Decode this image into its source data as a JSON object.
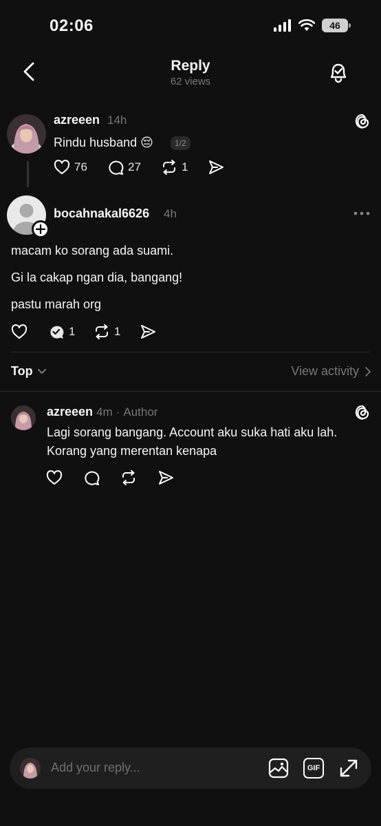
{
  "status_bar": {
    "time": "02:06",
    "battery": "46",
    "icons": [
      "signal-icon",
      "wifi-icon",
      "battery-icon"
    ]
  },
  "header": {
    "title": "Reply",
    "views": "62 views"
  },
  "parent_post": {
    "username": "azreeen",
    "time": "14h",
    "text": "Rindu husband 😔",
    "page_indicator": "1/2",
    "likes": "76",
    "comments": "27",
    "reposts": "1"
  },
  "main_post": {
    "username": "bocahnakal6626",
    "time": "4h",
    "lines": [
      "macam ko sorang ada suami.",
      "Gi la cakap ngan dia, bangang!",
      "pastu marah org"
    ],
    "comments": "1",
    "reposts": "1"
  },
  "sort_bar": {
    "sort_label": "Top",
    "activity_label": "View activity"
  },
  "reply": {
    "username": "azreeen",
    "time": "4m",
    "separator": "·",
    "author_label": "Author",
    "text_line1": "Lagi sorang bangang. Account aku suka hati aku lah.",
    "text_line2": "Korang yang merentan kenapa"
  },
  "composer": {
    "placeholder": "Add your reply...",
    "gif_label": "GIF"
  }
}
